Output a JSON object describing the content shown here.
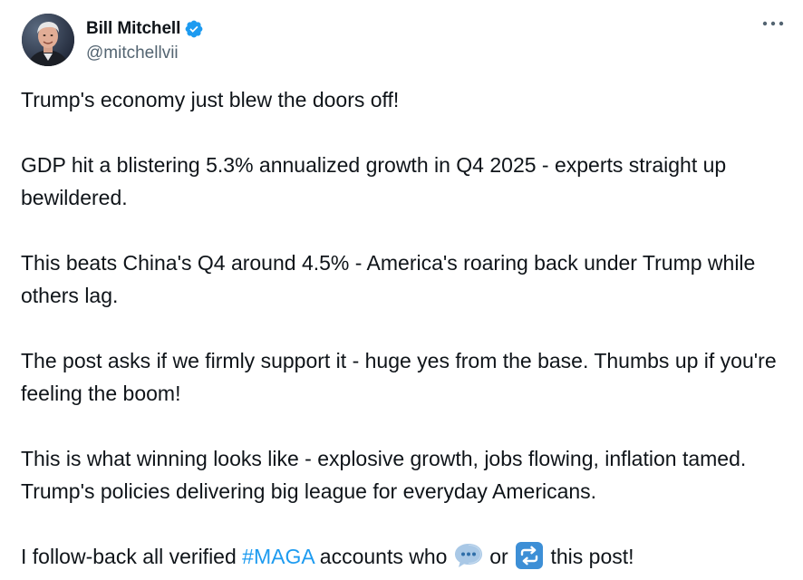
{
  "author": {
    "display_name": "Bill Mitchell",
    "handle": "@mitchellvii",
    "verified": true
  },
  "colors": {
    "text": "#0f1419",
    "secondary": "#536471",
    "link": "#1d9bf0",
    "verified_badge": "#1d9bf0",
    "reply_emoji": "#8fb8da",
    "repost_emoji": "#3d8fd6"
  },
  "icons": {
    "more": "more-horizontal-icon",
    "verified": "verified-badge-icon",
    "reply": "speech-bubble-icon",
    "repost": "repeat-arrows-icon"
  },
  "tweet": {
    "paragraphs": [
      "Trump's economy just blew the doors off!",
      "GDP hit a blistering 5.3% annualized growth in Q4 2025 - experts straight up bewildered.",
      "This beats China's Q4 around 4.5% - America's roaring back under Trump while others lag.",
      "The post asks if we firmly support it - huge yes from the base. Thumbs up if you're feeling the boom!",
      "This is what winning looks like - explosive growth, jobs flowing, inflation tamed. Trump's policies delivering big league for everyday Americans."
    ],
    "last_line": {
      "prefix": "I follow-back all verified ",
      "hashtag": "#MAGA",
      "middle": " accounts who ",
      "connector": " or ",
      "suffix": " this post!"
    }
  }
}
